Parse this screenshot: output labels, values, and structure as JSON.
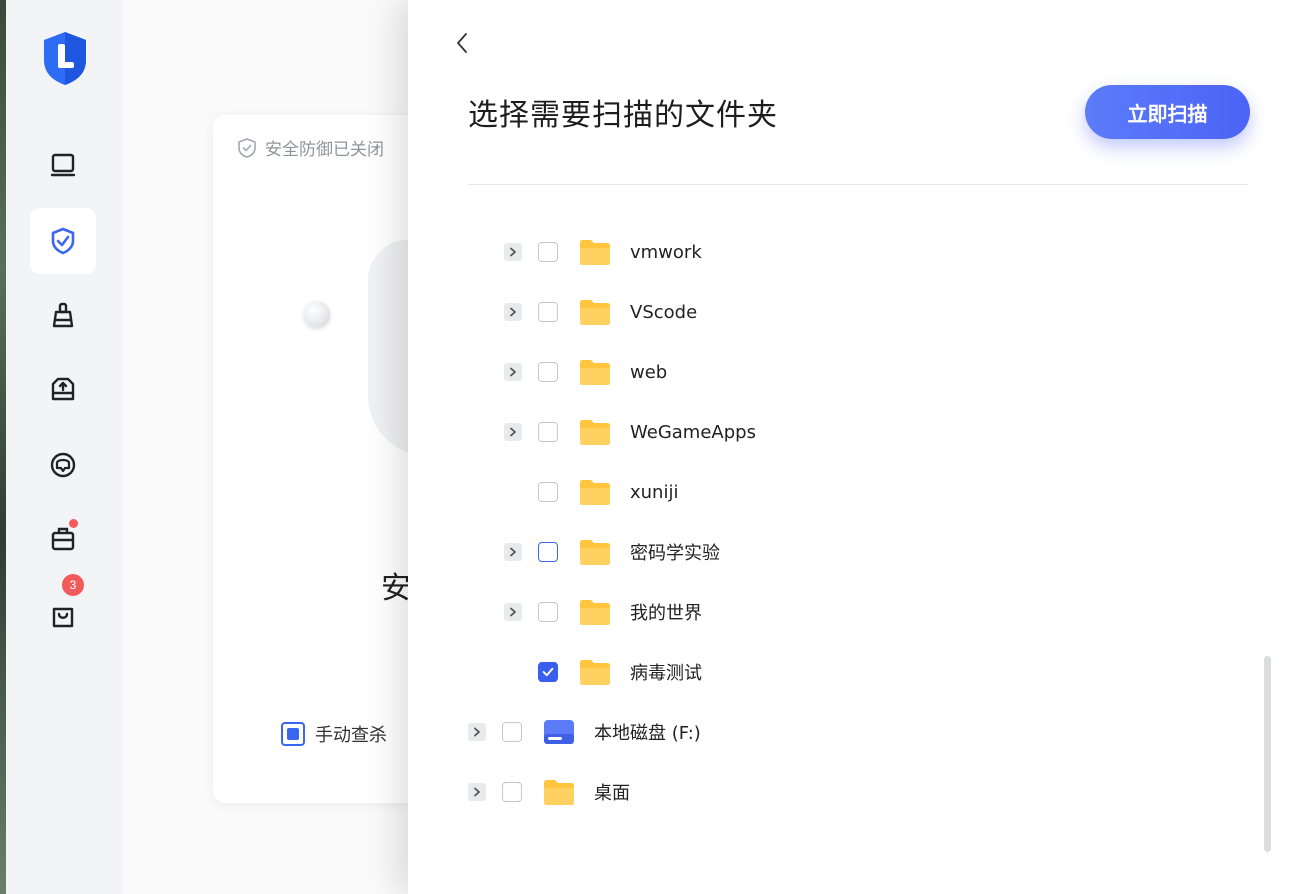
{
  "sidebar": {
    "items": [
      {
        "name": "computer",
        "icon": "monitor-icon"
      },
      {
        "name": "protection",
        "icon": "shield-check-icon",
        "active": true
      },
      {
        "name": "cleanup",
        "icon": "broom-icon"
      },
      {
        "name": "disk",
        "icon": "drive-upload-icon"
      },
      {
        "name": "privacy",
        "icon": "chat-radar-icon"
      },
      {
        "name": "toolbox",
        "icon": "toolbox-icon",
        "dot": true
      },
      {
        "name": "store",
        "icon": "bag-icon",
        "badge": "3"
      }
    ]
  },
  "card": {
    "status": "安全防御已关闭",
    "big_text": "安",
    "manual_label": "手动查杀"
  },
  "panel": {
    "title": "选择需要扫描的文件夹",
    "scan_button": "立即扫描",
    "items": [
      {
        "label": "vmwork",
        "expandable": true,
        "checked": false,
        "type": "folder"
      },
      {
        "label": "VScode",
        "expandable": true,
        "checked": false,
        "type": "folder"
      },
      {
        "label": "web",
        "expandable": true,
        "checked": false,
        "type": "folder"
      },
      {
        "label": "WeGameApps",
        "expandable": true,
        "checked": false,
        "type": "folder"
      },
      {
        "label": "xuniji",
        "expandable": false,
        "checked": false,
        "type": "folder"
      },
      {
        "label": "密码学实验",
        "expandable": true,
        "checked": false,
        "type": "folder",
        "hover": true
      },
      {
        "label": "我的世界",
        "expandable": true,
        "checked": false,
        "type": "folder"
      },
      {
        "label": "病毒测试",
        "expandable": false,
        "checked": true,
        "type": "folder"
      },
      {
        "label": "本地磁盘 (F:)",
        "expandable": true,
        "checked": false,
        "type": "disk"
      },
      {
        "label": "桌面",
        "expandable": true,
        "checked": false,
        "type": "folder"
      }
    ]
  },
  "colors": {
    "accent": "#4c63f5",
    "folder": "#ffc53d",
    "badge": "#f25b5b"
  }
}
